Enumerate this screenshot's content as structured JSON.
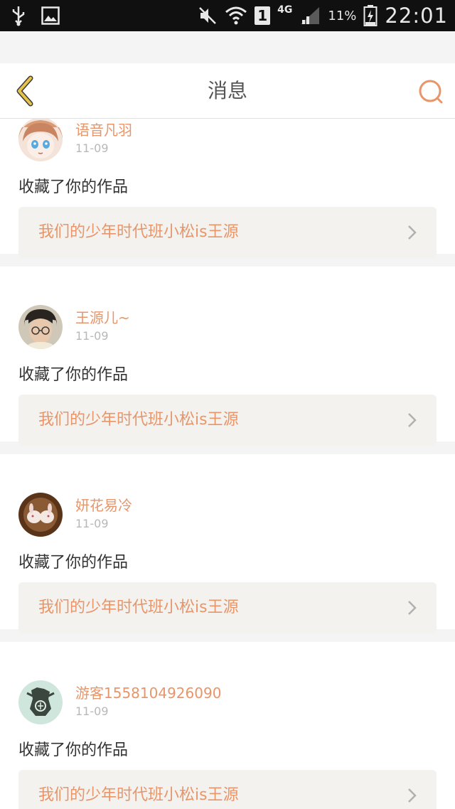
{
  "status_bar": {
    "network": "4G",
    "sim": "1",
    "battery_percent": "11%",
    "time": "22:01"
  },
  "header": {
    "title": "消息"
  },
  "notifications": [
    {
      "user": "语音凡羽",
      "date": "11-09",
      "action": "收藏了你的作品",
      "work": "我们的少年时代班小松is王源"
    },
    {
      "user": "王源儿~",
      "date": "11-09",
      "action": "收藏了你的作品",
      "work": "我们的少年时代班小松is王源"
    },
    {
      "user": "妍花易冷",
      "date": "11-09",
      "action": "收藏了你的作品",
      "work": "我们的少年时代班小松is王源"
    },
    {
      "user": "游客1558104926090",
      "date": "11-09",
      "action": "收藏了你的作品",
      "work": "我们的少年时代班小松is王源"
    }
  ],
  "colors": {
    "accent": "#e8956a",
    "back_icon": "#e8c34a",
    "card_link_bg": "#f3f2ee",
    "page_bg": "#f4f4f4"
  },
  "icons": {
    "back": "chevron-left-icon",
    "search": "search-icon",
    "card_arrow": "chevron-right-icon"
  }
}
